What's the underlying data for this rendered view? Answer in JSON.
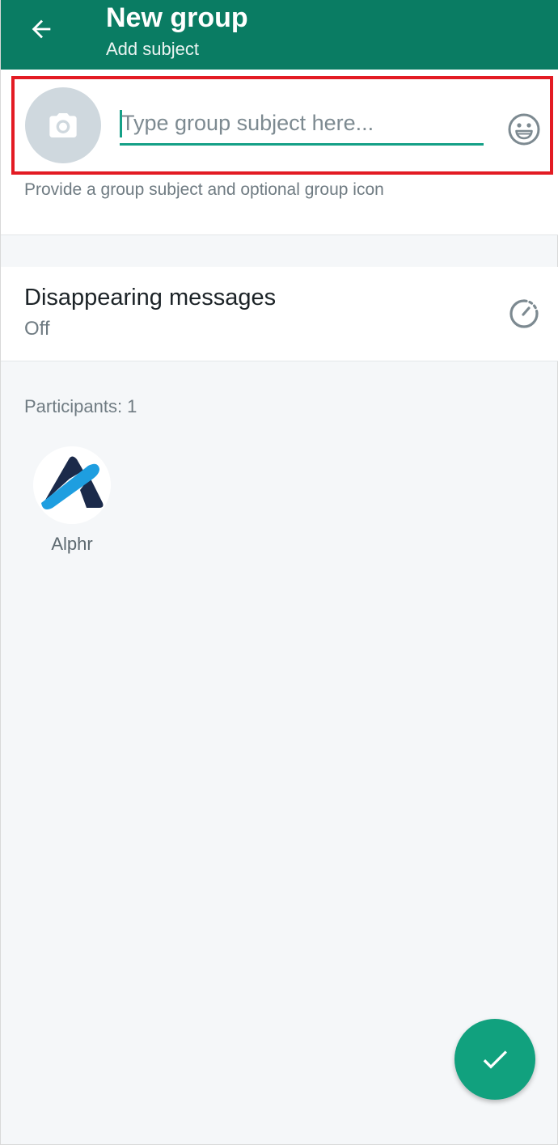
{
  "appbar": {
    "title": "New group",
    "subtitle": "Add subject",
    "back_icon": "arrow-left-icon"
  },
  "subject": {
    "placeholder": "Type group subject here...",
    "value": "",
    "hint": "Provide a group subject and optional group icon",
    "photo_icon": "camera-icon",
    "emoji_icon": "emoji-icon"
  },
  "disappearing": {
    "title": "Disappearing messages",
    "value": "Off",
    "icon": "timer-icon"
  },
  "participants": {
    "header": "Participants: 1",
    "items": [
      {
        "name": "Alphr",
        "avatar_icon": "alphr-logo"
      }
    ]
  },
  "fab": {
    "icon": "checkmark-icon"
  },
  "colors": {
    "appbar": "#0a7c63",
    "accent": "#14a087",
    "fab": "#11a17e",
    "highlight": "#e31b23",
    "background": "#f5f7f9"
  }
}
